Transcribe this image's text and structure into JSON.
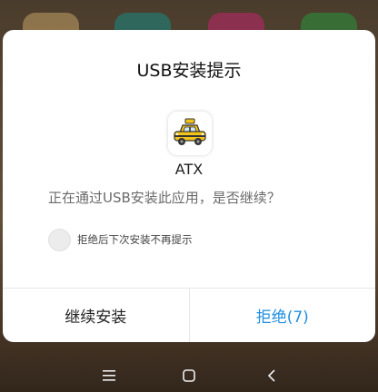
{
  "dialog": {
    "title": "USB安装提示",
    "app_icon": "taxi-icon",
    "app_name": "ATX",
    "message": "正在通过USB安装此应用，是否继续？",
    "checkbox_label": "拒绝后下次安装不再提示",
    "checkbox_checked": false,
    "continue_label": "继续安装",
    "reject_label": "拒绝(7)"
  },
  "colors": {
    "reject_accent": "#1f8fe0",
    "taxi_yellow": "#f2c31b"
  },
  "nav_bar": {
    "icons": [
      "menu-icon",
      "home-icon",
      "back-icon"
    ]
  }
}
